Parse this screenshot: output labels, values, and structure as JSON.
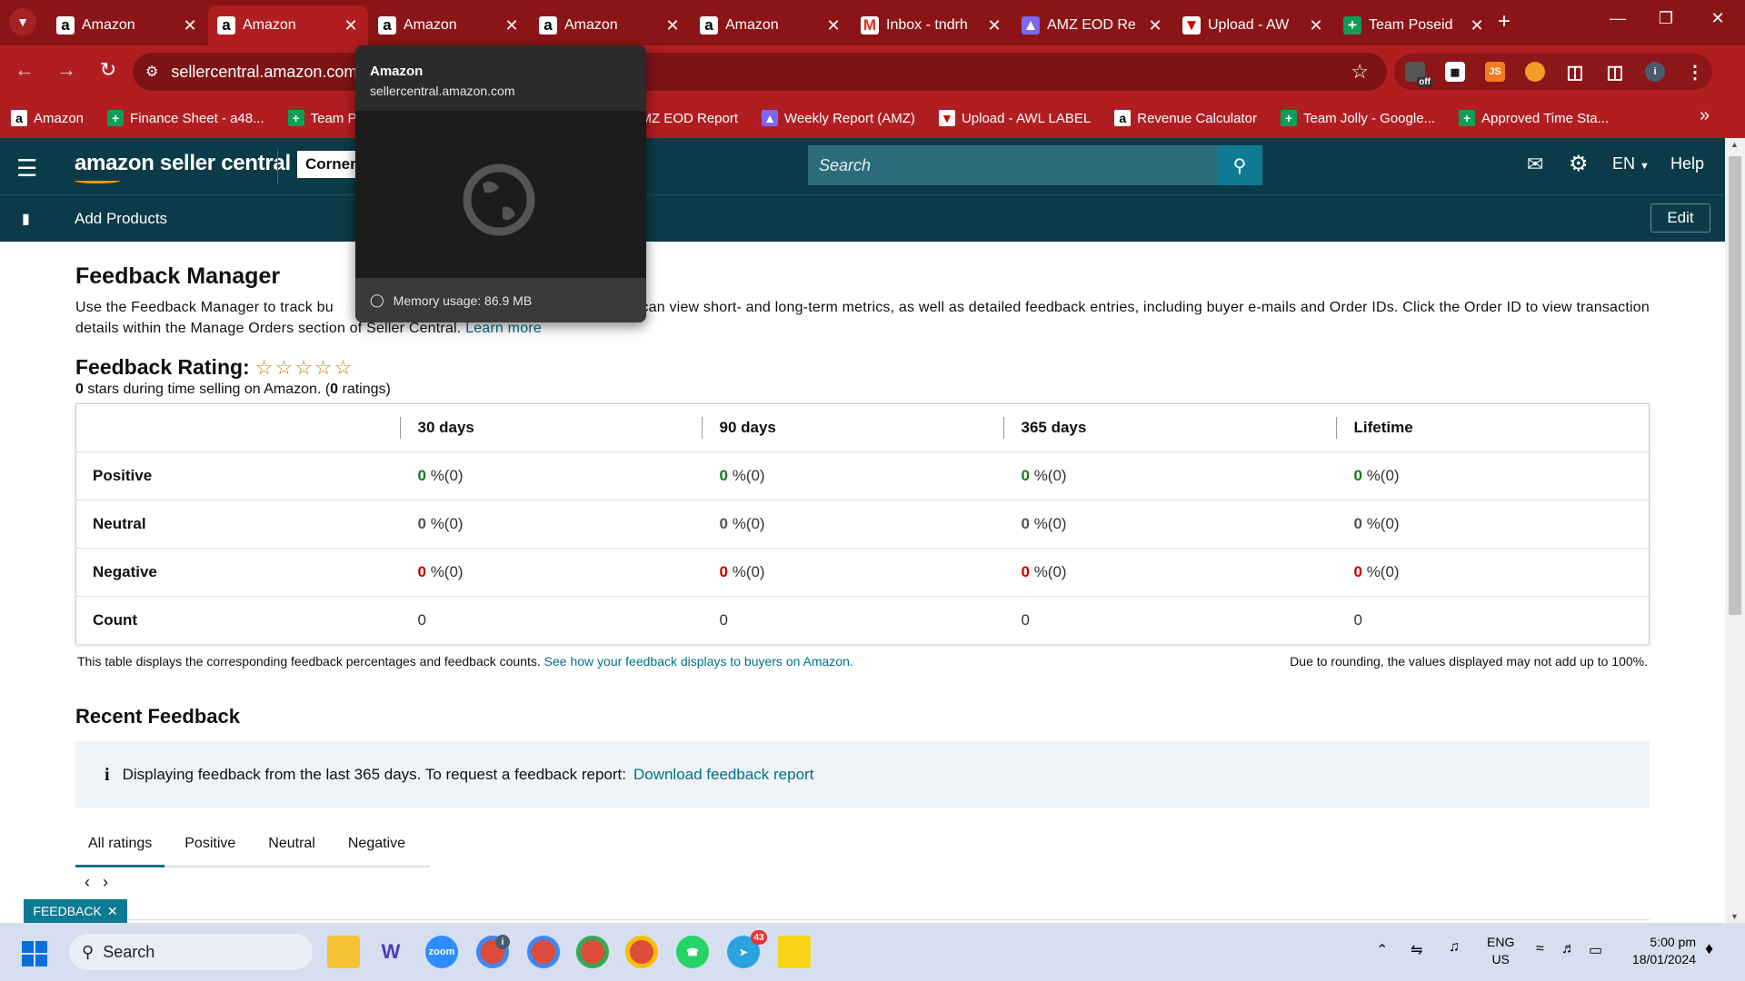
{
  "browser": {
    "tabs": [
      {
        "label": "Amazon",
        "favicon": "amazon-icon",
        "active": false
      },
      {
        "label": "Amazon",
        "favicon": "amazon-icon",
        "active": true
      },
      {
        "label": "Amazon",
        "favicon": "amazon-icon",
        "active": false
      },
      {
        "label": "Amazon",
        "favicon": "amazon-icon",
        "active": false
      },
      {
        "label": "Amazon",
        "favicon": "amazon-icon",
        "active": false
      },
      {
        "label": "Inbox - tndrh",
        "favicon": "gmail-icon",
        "active": false
      },
      {
        "label": "AMZ EOD Re",
        "favicon": "clickup-icon",
        "active": false
      },
      {
        "label": "Upload - AW",
        "favicon": "awl-icon",
        "active": false
      },
      {
        "label": "Team Poseid",
        "favicon": "sheets-icon",
        "active": false
      }
    ],
    "url": "sellercentral.amazon.com",
    "bookmarks": [
      {
        "label": "Amazon",
        "icon": "amazon-icon"
      },
      {
        "label": "Finance Sheet - a48...",
        "icon": "sheets-icon"
      },
      {
        "label": "Team P",
        "icon": "sheets-icon"
      },
      {
        "label": "MZ EOD Report",
        "icon": ""
      },
      {
        "label": "Weekly Report (AMZ)",
        "icon": "clickup-icon"
      },
      {
        "label": "Upload - AWL LABEL",
        "icon": "awl-icon"
      },
      {
        "label": "Revenue Calculator",
        "icon": "amazon-icon"
      },
      {
        "label": "Team Jolly - Google...",
        "icon": "sheets-icon"
      },
      {
        "label": "Approved Time Sta...",
        "icon": "sheets-icon"
      }
    ],
    "ext_off_badge": "off",
    "ext_js_label": "JS",
    "profile_initial": "i"
  },
  "tooltip": {
    "title": "Amazon",
    "domain": "sellercentral.amazon.com",
    "memory": "Memory usage: 86.9 MB"
  },
  "amazon": {
    "logo": "amazon seller central",
    "store": "Corner",
    "search_placeholder": "Search",
    "lang": "EN",
    "help": "Help",
    "bookmark_item": "Add Products",
    "edit": "Edit"
  },
  "page": {
    "title": "Feedback Manager",
    "desc_pre": "Use the Feedback Manager to track bu",
    "desc_mid": " can view short- and long-term metrics, as well as detailed feedback entries, including buyer e-mails and Order IDs. Click the Order ID to view transaction details within the Manage Orders section of Seller Central.",
    "learn_more": "Learn more",
    "rating_label": "Feedback Rating:",
    "rating_stars": 0,
    "rating_sub_count": "0",
    "rating_sub_text": " stars during time selling on Amazon. (",
    "rating_sub_ratings": "0",
    "rating_sub_end": " ratings)",
    "table": {
      "columns": [
        "30 days",
        "90 days",
        "365 days",
        "Lifetime"
      ],
      "rows": [
        {
          "label": "Positive",
          "type": "pos",
          "cells": [
            {
              "num": "0",
              "rest": " %(0)"
            },
            {
              "num": "0",
              "rest": " %(0)"
            },
            {
              "num": "0",
              "rest": " %(0)"
            },
            {
              "num": "0",
              "rest": " %(0)"
            }
          ]
        },
        {
          "label": "Neutral",
          "type": "neu",
          "cells": [
            {
              "num": "0",
              "rest": " %(0)"
            },
            {
              "num": "0",
              "rest": " %(0)"
            },
            {
              "num": "0",
              "rest": " %(0)"
            },
            {
              "num": "0",
              "rest": " %(0)"
            }
          ]
        },
        {
          "label": "Negative",
          "type": "neg",
          "cells": [
            {
              "num": "0",
              "rest": " %(0)"
            },
            {
              "num": "0",
              "rest": " %(0)"
            },
            {
              "num": "0",
              "rest": " %(0)"
            },
            {
              "num": "0",
              "rest": " %(0)"
            }
          ]
        },
        {
          "label": "Count",
          "type": "cnt",
          "cells": [
            {
              "num": "",
              "rest": "0"
            },
            {
              "num": "",
              "rest": "0"
            },
            {
              "num": "",
              "rest": "0"
            },
            {
              "num": "",
              "rest": "0"
            }
          ]
        }
      ]
    },
    "note_left": "This table displays the corresponding feedback percentages and feedback counts.",
    "note_link": "See how your feedback displays to buyers on Amazon.",
    "note_right": "Due to rounding, the values displayed may not add up to 100%.",
    "recent_title": "Recent Feedback",
    "info_text": "Displaying feedback from the last 365 days. To request a feedback report:",
    "info_link": "Download feedback report",
    "filter_tabs": [
      "All ratings",
      "Positive",
      "Neutral",
      "Negative"
    ],
    "feedback_btn": "FEEDBACK"
  },
  "taskbar": {
    "search": "Search",
    "zoom_label": "zoom",
    "chrome_badge": "i",
    "telegram_badge": "43",
    "lang1": "ENG",
    "lang2": "US",
    "time": "5:00 pm",
    "date": "18/01/2024"
  },
  "colors": {
    "chrome_dark": "#8b1516",
    "chrome_main": "#b01e22",
    "amazon_header": "#0b3b48",
    "link": "#007185",
    "positive": "#067d1e",
    "negative": "#c40000"
  }
}
